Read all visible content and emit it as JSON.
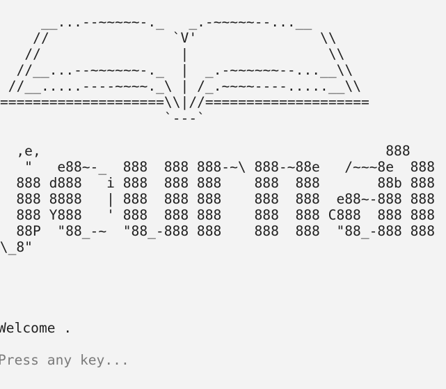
{
  "terminal": {
    "ascii_book": "     __...--~~~~~-._   _.-~~~~~--...__\n    //               `V'               \\\\\n   //                 |                 \\\\\n  //__...--~~~~~~-._  |  _.-~~~~~~--...__\\\\\n //__.....----~~~~._\\ | /_.~~~~----.....__\\\\\n====================\\\\|//====================\n                    `---`",
    "ascii_logo": "   ,e,                                          888\n    \"   e88~-_  888  888 888-~\\ 888-~88e   /~~~8e  888\n   888 d888   i 888  888 888    888  888       88b 888\n   888 8888   | 888  888 888    888  888  e88~-888 888\n   888 Y888   ' 888  888 888    888  888 C888  888 888\n   88P  \"88_-~  \"88_-888 888    888  888  \"88_-888 888\n \\_8\"",
    "welcome_text": "Welcome .",
    "prompt_text": "Press any key..."
  }
}
